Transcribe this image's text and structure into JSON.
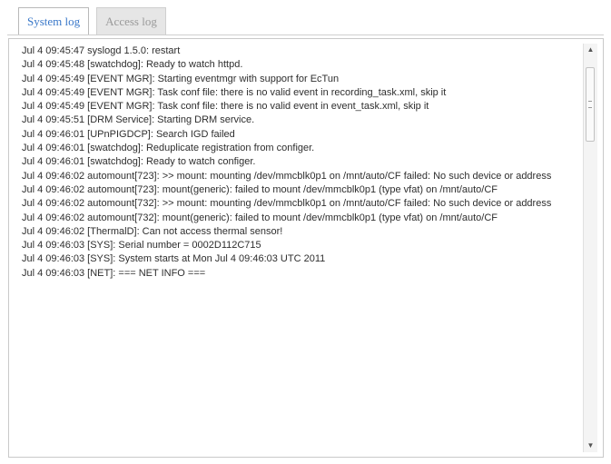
{
  "tabs": [
    {
      "label": "System log",
      "active": true
    },
    {
      "label": "Access log",
      "active": false
    }
  ],
  "log_lines": [
    "Jul 4 09:45:47 syslogd 1.5.0: restart",
    "Jul 4 09:45:48 [swatchdog]: Ready to watch httpd.",
    "Jul 4 09:45:49 [EVENT MGR]: Starting eventmgr with support for EcTun",
    "Jul 4 09:45:49 [EVENT MGR]: Task conf file: there is no valid event in recording_task.xml, skip it",
    "Jul 4 09:45:49 [EVENT MGR]: Task conf file: there is no valid event in event_task.xml, skip it",
    "Jul 4 09:45:51 [DRM Service]: Starting DRM service.",
    "Jul 4 09:46:01 [UPnPIGDCP]: Search IGD failed",
    "Jul 4 09:46:01 [swatchdog]: Reduplicate registration from configer.",
    "Jul 4 09:46:01 [swatchdog]: Ready to watch configer.",
    "Jul 4 09:46:02 automount[723]: >> mount: mounting /dev/mmcblk0p1 on /mnt/auto/CF failed: No such device or address",
    "Jul 4 09:46:02 automount[723]: mount(generic): failed to mount /dev/mmcblk0p1 (type vfat) on /mnt/auto/CF",
    "Jul 4 09:46:02 automount[732]: >> mount: mounting /dev/mmcblk0p1 on /mnt/auto/CF failed: No such device or address",
    "Jul 4 09:46:02 automount[732]: mount(generic): failed to mount /dev/mmcblk0p1 (type vfat) on /mnt/auto/CF",
    "Jul 4 09:46:02 [ThermalD]: Can not access thermal sensor!",
    "Jul 4 09:46:03 [SYS]: Serial number = 0002D112C715",
    "Jul 4 09:46:03 [SYS]: System starts at Mon Jul 4 09:46:03 UTC 2011",
    "Jul 4 09:46:03 [NET]: === NET INFO ==="
  ],
  "scrollbar": {
    "up_icon": "arrow-up-icon",
    "down_icon": "arrow-down-icon",
    "scroll_position": 0.0
  }
}
